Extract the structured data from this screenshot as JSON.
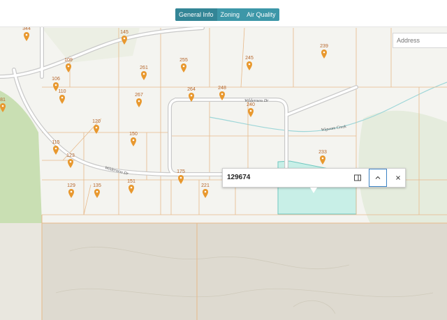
{
  "tabs": [
    {
      "label": "General Info"
    },
    {
      "label": "Zoning"
    },
    {
      "label": "Air Quality"
    }
  ],
  "search": {
    "placeholder": "Address"
  },
  "popup": {
    "title": "129674"
  },
  "streets": {
    "wilderness_dr_north": "Wilderness Dr",
    "wilderness_dr_south": "Wilderness Dr",
    "creek": "Wigwam Creek"
  },
  "parcels": [
    "344",
    "145",
    "239",
    "109",
    "261",
    "255",
    "245",
    "106",
    "110",
    "267",
    "264",
    "248",
    "240",
    "81",
    "120",
    "150",
    "115",
    "123",
    "233",
    "175",
    "151",
    "129",
    "135",
    "221"
  ],
  "colors": {
    "accent": "#3d97a8",
    "parcel_line": "#e7b98a",
    "marker": "#e8982e",
    "selected_parcel": "#c8efe7",
    "land": "#f2f2ed",
    "forest": "#c9dfb3",
    "water": "#9dd6d8"
  }
}
